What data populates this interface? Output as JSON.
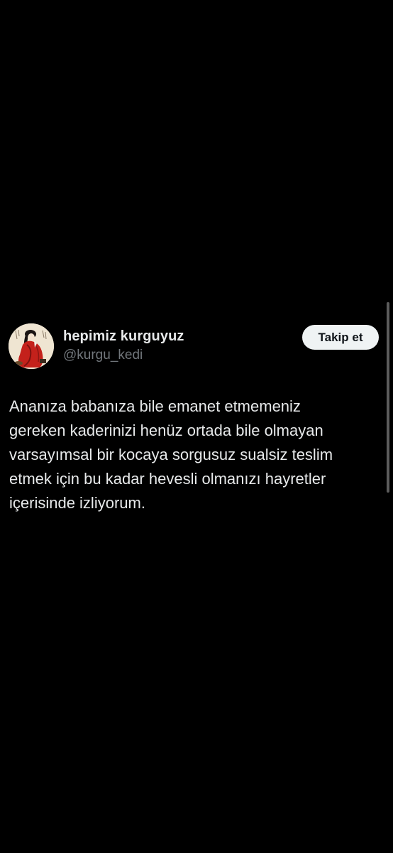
{
  "tweet": {
    "display_name": "hepimiz kurguyuz",
    "handle": "@kurgu_kedi",
    "follow_label": "Takip et",
    "text_lines": [
      "Ananıza babanıza bile emanet etmemeniz",
      "gereken kaderinizi henüz ortada bile olmayan",
      "varsayımsal bir kocaya sorgusuz sualsiz teslim",
      "etmek için bu kadar hevesli olmanızı hayretler",
      "içerisinde izliyorum."
    ],
    "avatar_icon": "painted-woman-portrait"
  },
  "colors": {
    "background": "#000000",
    "primary_text": "#e7e9ea",
    "secondary_text": "#71767b",
    "button_bg": "#eff3f4",
    "button_text": "#0f1419"
  }
}
